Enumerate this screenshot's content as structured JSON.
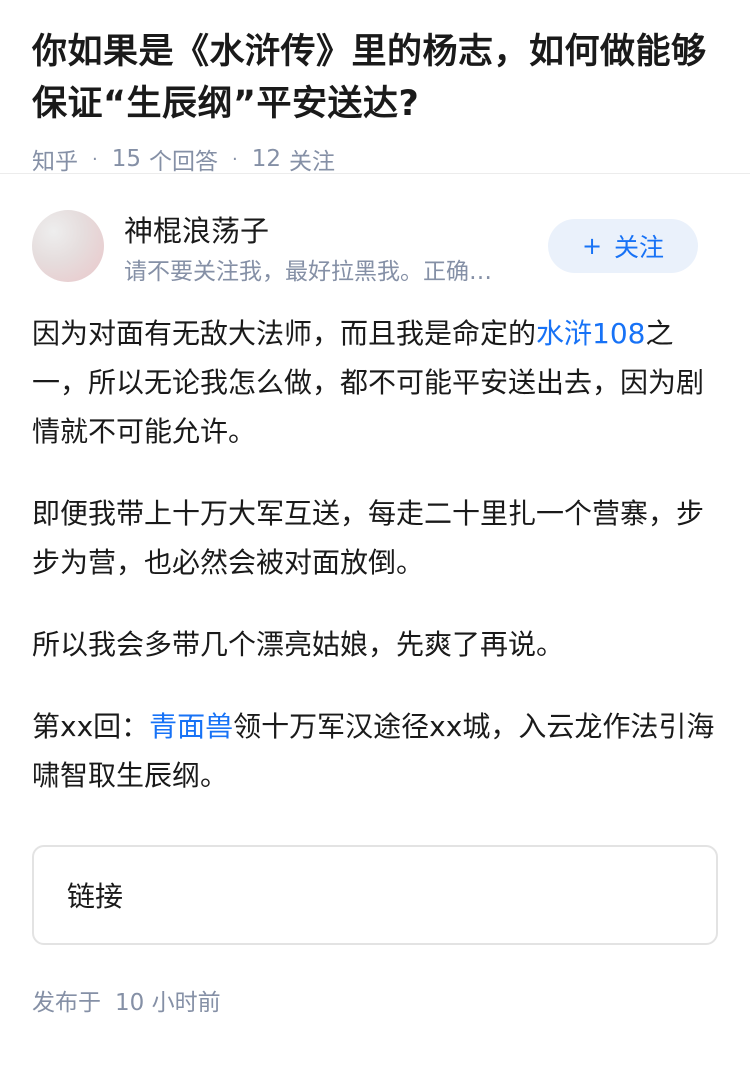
{
  "question": {
    "title": "你如果是《水浒传》里的杨志，如何做能够保证“生辰纲”平安送达?",
    "source": "知乎",
    "answers_count": "15",
    "answers_label": "个回答",
    "follows_count": "12",
    "follows_label": "关注"
  },
  "author": {
    "name": "神棍浪荡子",
    "bio": "请不要关注我，最好拉黑我。正确…",
    "follow_button": "关注",
    "follow_plus": "+"
  },
  "answer": {
    "p1_a": "因为对面有无敌大法师，而且我是命定的",
    "p1_link": "水浒108",
    "p1_b": "之一，所以无论我怎么做，都不可能平安送出去，因为剧情就不可能允许。",
    "p2": "即便我带上十万大军互送，每走二十里扎一个营寨，步步为营，也必然会被对面放倒。",
    "p3": "所以我会多带几个漂亮姑娘，先爽了再说。",
    "p4_a": "第xx回：",
    "p4_link": "青面兽",
    "p4_b": "领十万军汉途径xx城，入云龙作法引海啸智取生辰纲。"
  },
  "link_card": {
    "label": "链接"
  },
  "footer": {
    "published_label": "发布于",
    "published_time": "10 小时前"
  },
  "colors": {
    "accent": "#1772f6",
    "meta": "#8590a6",
    "follow_bg": "#eaf1fb"
  }
}
